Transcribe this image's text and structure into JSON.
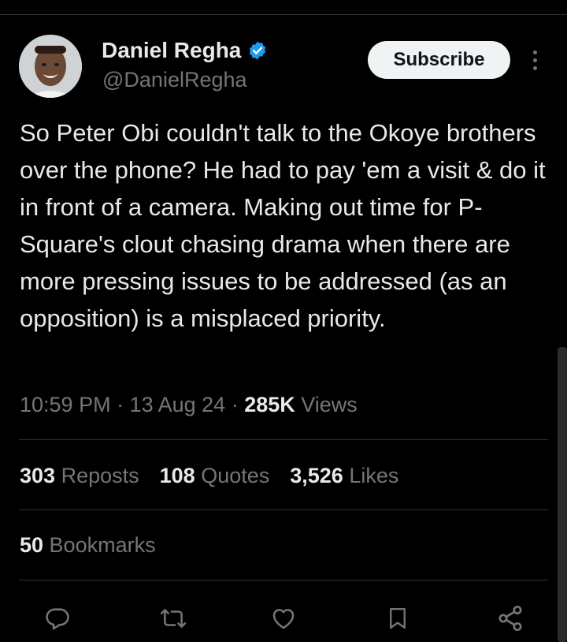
{
  "author": {
    "name": "Daniel Regha",
    "handle": "@DanielRegha",
    "verified": true
  },
  "header": {
    "subscribe_label": "Subscribe",
    "more_icon": "more-vertical-icon"
  },
  "tweet": {
    "text": "So Peter Obi couldn't talk to the Okoye brothers over the phone? He had to pay 'em a visit & do it in front of a camera. Making out time for P-Square's clout chasing drama when there are more pressing issues to be addressed (as an opposition) is a misplaced priority.",
    "time": "10:59 PM",
    "sep1": " · ",
    "date": "13 Aug 24",
    "sep2": " · ",
    "views_count": "285K",
    "views_label": " Views"
  },
  "stats": {
    "reposts_count": "303",
    "reposts_label": " Reposts",
    "quotes_count": "108",
    "quotes_label": " Quotes",
    "likes_count": "3,526",
    "likes_label": " Likes",
    "bookmarks_count": "50",
    "bookmarks_label": " Bookmarks"
  },
  "actions": [
    "reply-icon",
    "repost-icon",
    "like-icon",
    "bookmark-icon",
    "share-icon"
  ],
  "colors": {
    "background": "#000000",
    "text": "#e7e9ea",
    "muted": "#71767b",
    "verified": "#1d9bf0",
    "divider": "#2f3336"
  }
}
